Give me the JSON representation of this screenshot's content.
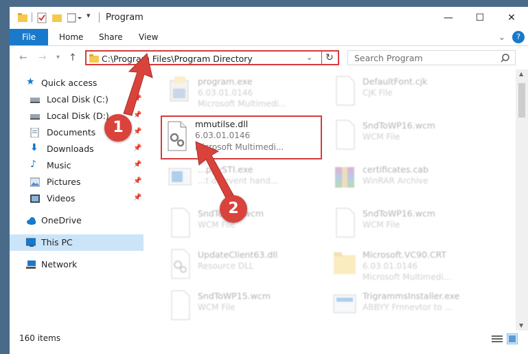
{
  "window": {
    "title": "Program",
    "controls": {
      "minimize": "—",
      "maximize": "☐",
      "close": "✕"
    }
  },
  "ribbon": {
    "tabs": [
      {
        "label": "File"
      },
      {
        "label": "Home"
      },
      {
        "label": "Share"
      },
      {
        "label": "View"
      }
    ],
    "help": "?"
  },
  "navigation": {
    "address": "C:\\Program Files\\Program Directory",
    "search_placeholder": "Search Program"
  },
  "sidebar": {
    "items": [
      {
        "label": "Quick access",
        "icon": "star-icon"
      },
      {
        "label": "Local Disk (C:)",
        "icon": "drive-icon"
      },
      {
        "label": "Local Disk (D:)",
        "icon": "drive-icon"
      },
      {
        "label": "Documents",
        "icon": "documents-icon"
      },
      {
        "label": "Downloads",
        "icon": "download-icon"
      },
      {
        "label": "Music",
        "icon": "music-icon"
      },
      {
        "label": "Pictures",
        "icon": "pictures-icon"
      },
      {
        "label": "Videos",
        "icon": "videos-icon"
      },
      {
        "label": "OneDrive",
        "icon": "cloud-icon"
      },
      {
        "label": "This PC",
        "icon": "computer-icon"
      },
      {
        "label": "Network",
        "icon": "network-icon"
      }
    ]
  },
  "files": [
    {
      "name": "program.exe",
      "meta": "6.03.01.0146",
      "meta2": "Microsoft Multimedi..."
    },
    {
      "name": "DefaultFont.cjk",
      "meta": "CJK File",
      "meta2": ""
    },
    {
      "name": "mmutilse.dll",
      "meta": "6.03.01.0146",
      "meta2": "Microsoft Multimedi..."
    },
    {
      "name": "SndToWP16.wcm",
      "meta": "WCM File",
      "meta2": ""
    },
    {
      "name": "...ppySTI.exe",
      "meta": "...t ds event hand...",
      "meta2": ""
    },
    {
      "name": "certificates.cab",
      "meta": "WinRAR Archive",
      "meta2": ""
    },
    {
      "name": "SndToWP...wcm",
      "meta": "WCM File",
      "meta2": ""
    },
    {
      "name": "SndToWP16.wcm",
      "meta": "WCM File",
      "meta2": ""
    },
    {
      "name": "UpdateClient63.dll",
      "meta": "Resource DLL",
      "meta2": ""
    },
    {
      "name": "Microsoft.VC90.CRT",
      "meta": "6.03.01.0146",
      "meta2": "Microsoft Multimedi..."
    },
    {
      "name": "SndToWP15.wcm",
      "meta": "WCM File",
      "meta2": ""
    },
    {
      "name": "TrigrammsInstaller.exe",
      "meta": "ABBYY Frnnevtor to ...",
      "meta2": ""
    }
  ],
  "status": {
    "item_count": "160 items"
  },
  "annotations": {
    "step1": "1",
    "step2": "2"
  },
  "colors": {
    "accent": "#1979ca",
    "highlight": "#d63a3a",
    "selection": "#cce4f7"
  }
}
